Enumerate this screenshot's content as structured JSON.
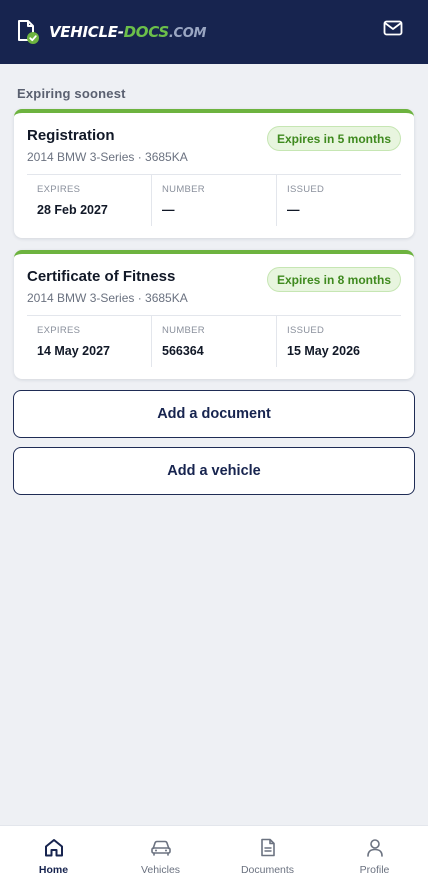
{
  "header": {
    "logo_vehicle": "VEHICLE-",
    "logo_docs": "DOCS",
    "logo_com": ".COM"
  },
  "section": {
    "title": "Expiring soonest"
  },
  "cards": [
    {
      "title": "Registration",
      "subtitle": "2014 BMW 3-Series · 3685KA",
      "badge": "Expires in 5 months",
      "expires_label": "EXPIRES",
      "expires_value": "28 Feb 2027",
      "number_label": "NUMBER",
      "number_value": "—",
      "issued_label": "ISSUED",
      "issued_value": "—"
    },
    {
      "title": "Certificate of Fitness",
      "subtitle": "2014 BMW 3-Series · 3685KA",
      "badge": "Expires in 8 months",
      "expires_label": "EXPIRES",
      "expires_value": "14 May 2027",
      "number_label": "NUMBER",
      "number_value": "566364",
      "issued_label": "ISSUED",
      "issued_value": "15 May 2026"
    }
  ],
  "actions": {
    "add_document": "Add a document",
    "add_vehicle": "Add a vehicle"
  },
  "nav": {
    "home": "Home",
    "vehicles": "Vehicles",
    "documents": "Documents",
    "profile": "Profile",
    "active": "Home"
  },
  "colors": {
    "header_bg": "#17244f",
    "accent_green": "#6db33f",
    "background": "#eef0f4"
  }
}
